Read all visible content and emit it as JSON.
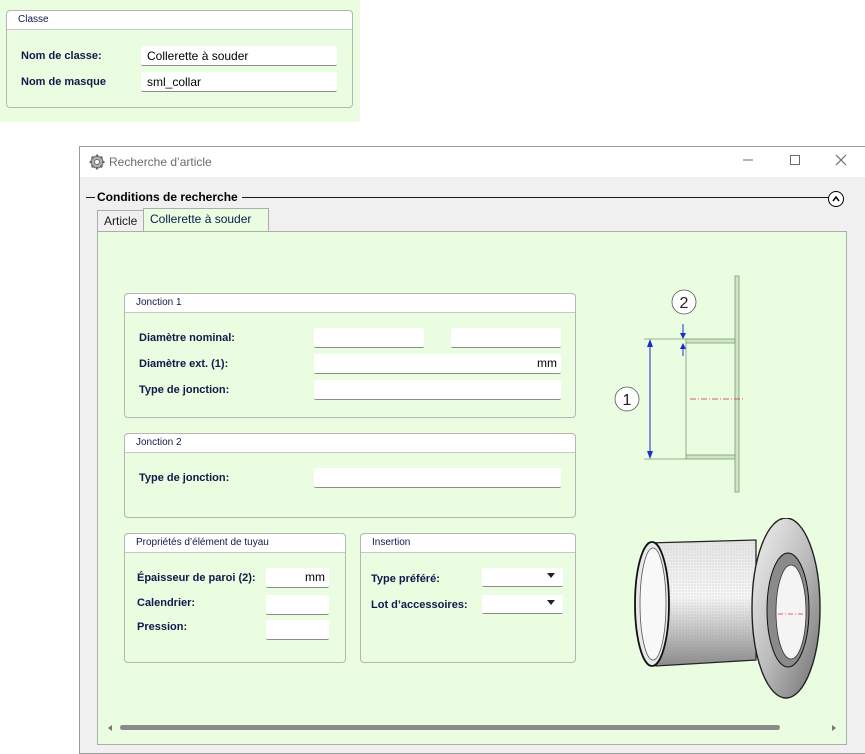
{
  "classe": {
    "title": "Classe",
    "rows": [
      {
        "label": "Nom de classe:",
        "value": "Collerette à souder"
      },
      {
        "label": "Nom de masque",
        "value": "sml_collar"
      }
    ]
  },
  "window": {
    "title": "Recherche d’article",
    "section_title": "Conditions de recherche",
    "tabs": [
      "Article",
      "Collerette à souder"
    ]
  },
  "jonction1": {
    "title": "Jonction 1",
    "diam_nominal_label": "Diamètre nominal:",
    "diam_ext_label": "Diamètre ext. (1):",
    "diam_ext_unit": "mm",
    "type_label": "Type de jonction:"
  },
  "jonction2": {
    "title": "Jonction 2",
    "type_label": "Type de jonction:"
  },
  "props": {
    "title": "Propriétés d’élément de tuyau",
    "epaisseur_label": "Épaisseur de paroi (2):",
    "epaisseur_unit": "mm",
    "calendrier_label": "Calendrier:",
    "pression_label": "Pression:"
  },
  "insertion": {
    "title": "Insertion",
    "type_label": "Type préféré:",
    "lot_label": "Lot d’accessoires:"
  },
  "diagram": {
    "label_1": "1",
    "label_2": "2"
  }
}
